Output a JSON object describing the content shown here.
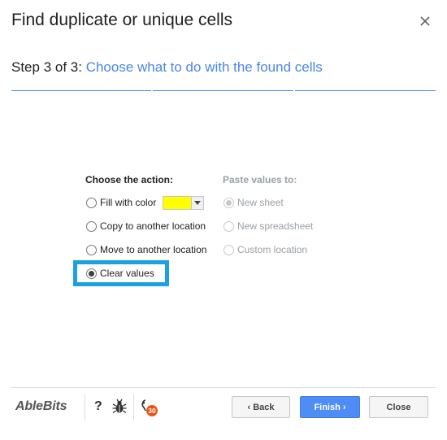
{
  "dialog": {
    "title": "Find duplicate or unique cells",
    "close_icon": "close-icon"
  },
  "step": {
    "count": "Step 3 of 3: ",
    "description": "Choose what to do with the found cells"
  },
  "action_group": {
    "header": "Choose the action:",
    "options": [
      {
        "label": "Fill with color",
        "selected": false
      },
      {
        "label": "Copy to another location",
        "selected": false
      },
      {
        "label": "Move to another location",
        "selected": false
      },
      {
        "label": "Clear values",
        "selected": true
      }
    ],
    "fill_color": "#ffff00"
  },
  "paste_group": {
    "header": "Paste values to:",
    "options": [
      {
        "label": "New sheet",
        "selected": true,
        "disabled": true
      },
      {
        "label": "New spreadsheet",
        "selected": false,
        "disabled": true
      },
      {
        "label": "Custom location",
        "selected": false,
        "disabled": true
      }
    ]
  },
  "footer": {
    "logo": "AbleBits",
    "help": "?",
    "bug_icon": "bug-icon",
    "countdown_icon": "countdown-icon",
    "countdown_badge": "30",
    "back_label": "‹ Back",
    "finish_label": "Finish ›",
    "close_label": "Close"
  },
  "colors": {
    "accent": "#4a86e8",
    "finish_button": "#4d8df5",
    "highlight": "#1aa0e3",
    "badge": "#e8541a"
  }
}
